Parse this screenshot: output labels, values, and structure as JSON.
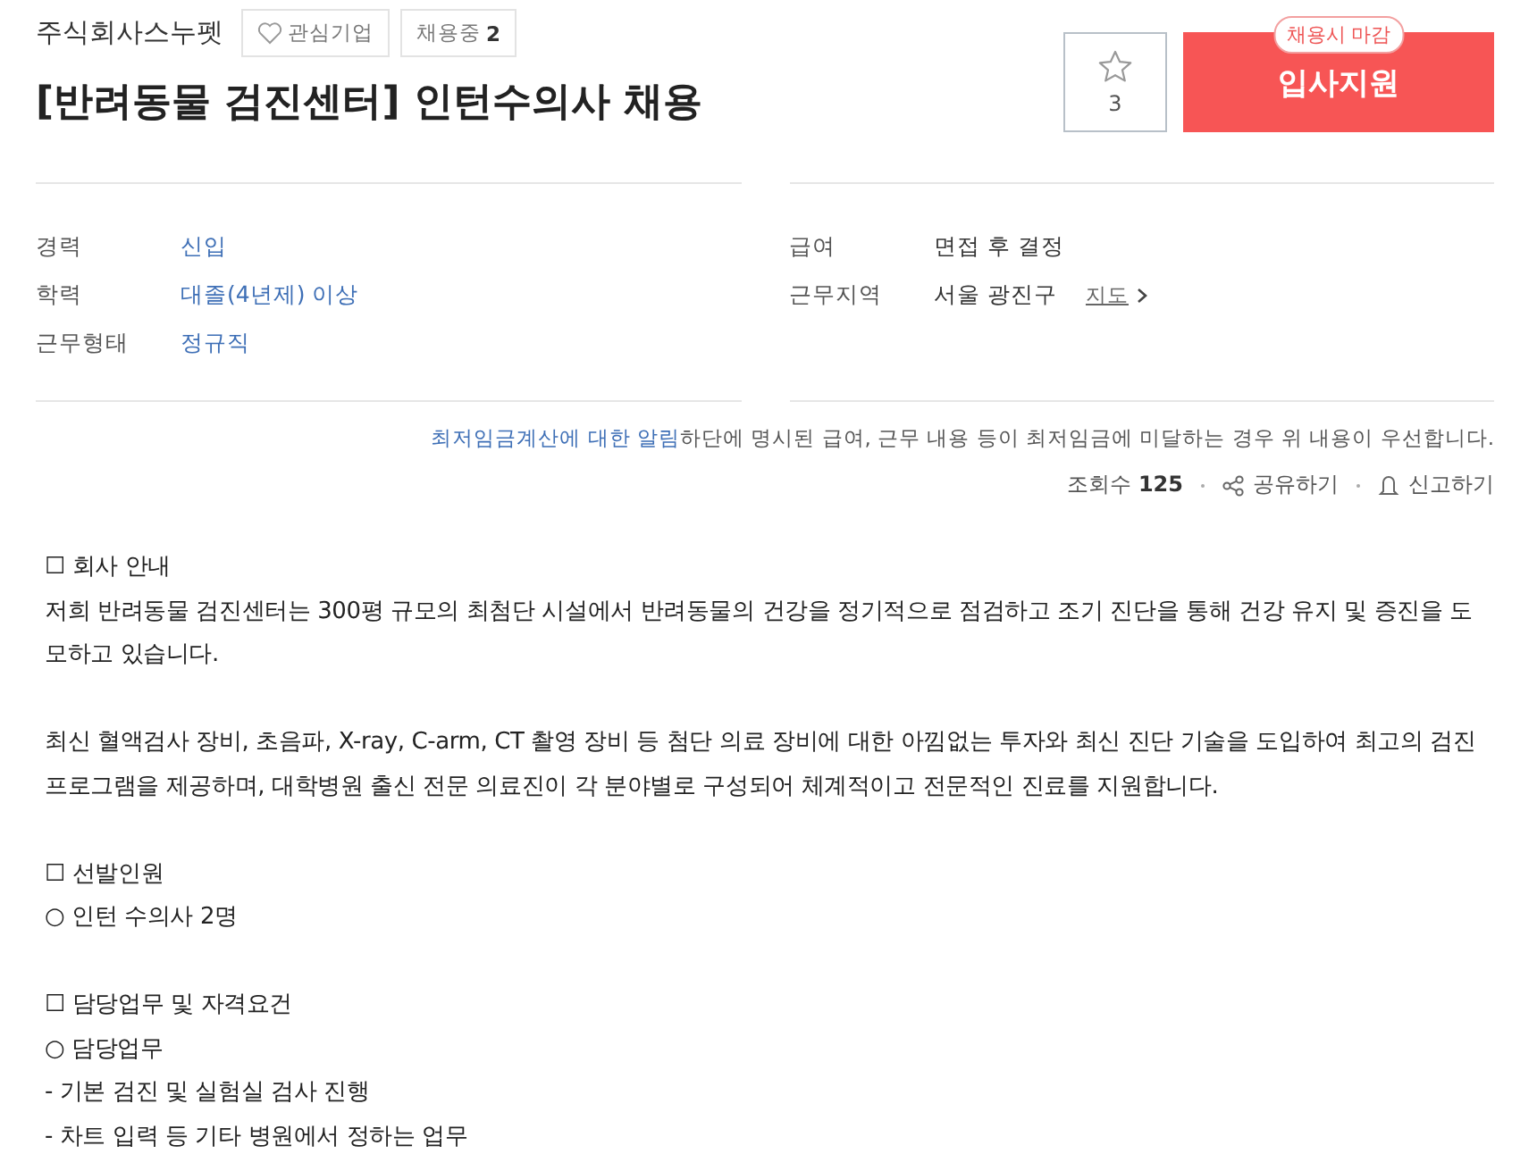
{
  "company": {
    "name": "주식회사스누펫",
    "favorite_label": "관심기업",
    "favorite": false,
    "hiring_label": "채용중",
    "hiring_count": "2"
  },
  "title": "[반려동물 검진센터] 인턴수의사 채용",
  "scrap": {
    "count": "3",
    "on": false
  },
  "apply": {
    "label": "입사지원",
    "badge": "채용시 마감"
  },
  "info_left": [
    {
      "label": "경력",
      "value": "신입"
    },
    {
      "label": "학력",
      "value": "대졸(4년제) 이상"
    },
    {
      "label": "근무형태",
      "value": "정규직"
    }
  ],
  "info_right": [
    {
      "label": "급여",
      "value": "면접 후 결정"
    },
    {
      "label": "근무지역",
      "value": "서울 광진구",
      "link": "지도"
    }
  ],
  "notice": {
    "link": "최저임금계산에 대한 알림",
    "text": "하단에 명시된 급여, 근무 내용 등이 최저임금에 미달하는 경우 위 내용이 우선합니다."
  },
  "stats": {
    "views_label": "조회수",
    "views": "125",
    "share": "공유하기",
    "report": "신고하기"
  },
  "body": [
    {
      "kind": "line",
      "text": "☐ 회사 안내"
    },
    {
      "kind": "line",
      "text": "저희 반려동물 검진센터는 300평 규모의 최첨단 시설에서 반려동물의 건강을 정기적으로 점검하고 조기 진단을 통해 건강 유지 및 증진을 도모하고 있습니다."
    },
    {
      "kind": "gap"
    },
    {
      "kind": "line",
      "text": "최신 혈액검사 장비, 초음파, X-ray, C-arm, CT 촬영 장비 등 첨단 의료 장비에 대한 아낌없는 투자와 최신 진단 기술을 도입하여 최고의 검진 프로그램을 제공하며, 대학병원 출신 전문 의료진이 각 분야별로 구성되어 체계적이고 전문적인 진료를 지원합니다."
    },
    {
      "kind": "gap"
    },
    {
      "kind": "line",
      "text": "☐ 선발인원"
    },
    {
      "kind": "line",
      "text": "○ 인턴 수의사 2명"
    },
    {
      "kind": "gap"
    },
    {
      "kind": "line",
      "text": "☐ 담당업무 및 자격요건"
    },
    {
      "kind": "line",
      "text": "○ 담당업무"
    },
    {
      "kind": "line",
      "text": "- 기본 검진 및 실험실 검사 진행"
    },
    {
      "kind": "line",
      "text": "- 차트 입력 등 기타 병원에서 정하는 업무"
    }
  ]
}
